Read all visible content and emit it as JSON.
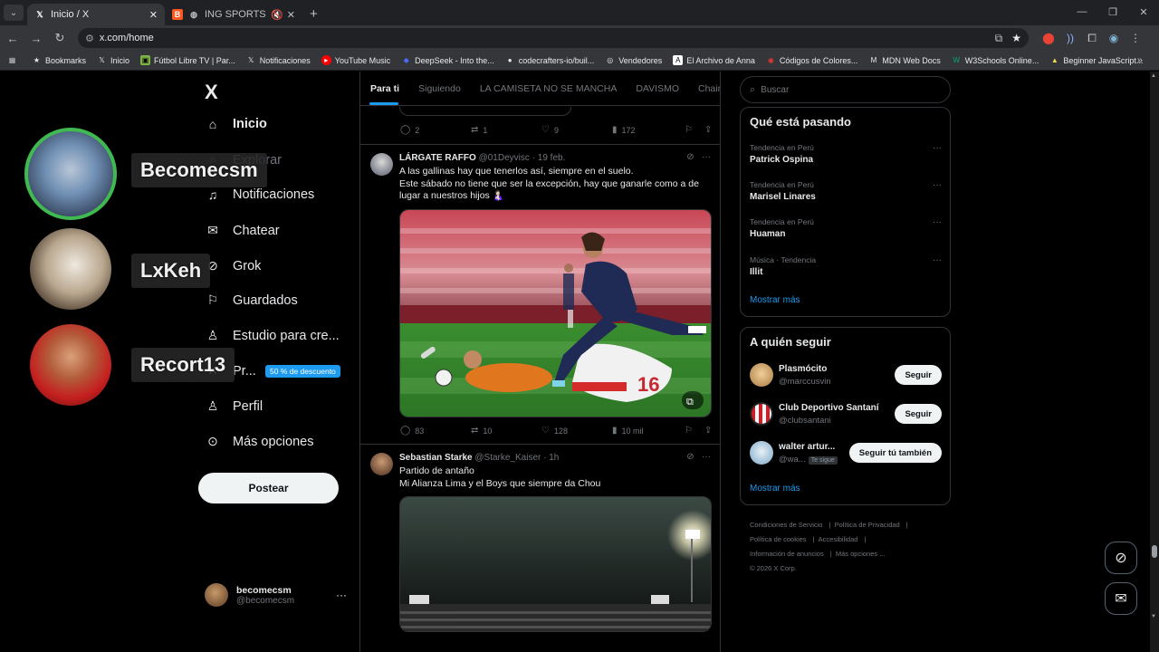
{
  "browser": {
    "tabs": [
      {
        "title": "Inicio / X",
        "active": true
      },
      {
        "title": "ING SPORTS - Deportes",
        "active": false
      }
    ],
    "url": "x.com/home",
    "bookmarks": [
      "Bookmarks",
      "Inicio",
      "Fútbol Libre TV | Par...",
      "Notificaciones",
      "YouTube Music",
      "DeepSeek - Into the...",
      "codecrafters-io/buil...",
      "Vendedores",
      "El Archivo de Anna",
      "Códigos de Colores...",
      "MDN Web Docs",
      "W3Schools Online...",
      "Beginner JavaScript..."
    ]
  },
  "overlay": {
    "users": [
      "Becomecsm",
      "LxKeh",
      "Recort13"
    ]
  },
  "sidebar": {
    "logo": "X",
    "items": [
      {
        "label": "Inicio",
        "icon": "home-icon"
      },
      {
        "label": "Explorar",
        "icon": "search-icon"
      },
      {
        "label": "Notificaciones",
        "icon": "bell-icon"
      },
      {
        "label": "Chatear",
        "icon": "mail-icon"
      },
      {
        "label": "Grok",
        "icon": "grok-icon"
      },
      {
        "label": "Guardados",
        "icon": "bookmark-icon"
      },
      {
        "label": "Estudio para cre...",
        "icon": "studio-icon"
      },
      {
        "label": "Pr...",
        "icon": "premium-icon"
      },
      {
        "label": "Perfil",
        "icon": "person-icon"
      },
      {
        "label": "Más opciones",
        "icon": "more-circle-icon"
      }
    ],
    "promo_badge": "50 % de descuento",
    "post_button": "Postear",
    "account": {
      "name": "becomecsm",
      "handle": "@becomecsm"
    }
  },
  "feed": {
    "tabs": [
      "Para ti",
      "Siguiendo",
      "LA CAMISETA NO SE MANCHA",
      "DAVISMO",
      "Chainsa"
    ],
    "prev_stats": {
      "replies": "2",
      "reposts": "1",
      "likes": "9",
      "views": "172"
    },
    "tweets": [
      {
        "name": "LÁRGATE RAFFO",
        "handle": "@01Deyvisc",
        "time": "19 feb.",
        "line1": "A las gallinas hay que tenerlos así, siempre en el suelo.",
        "line2": "Este sábado no tiene que ser la excepción, hay que ganarle como a de lugar a nuestros hijos 🤱🏻",
        "stats": {
          "replies": "83",
          "reposts": "10",
          "likes": "128",
          "views": "10 mil"
        }
      },
      {
        "name": "Sebastian Starke",
        "handle": "@Starke_Kaiser",
        "time": "1h",
        "line1": "Partido de antaño",
        "line2": "Mi Alianza Lima y el Boys que siempre da Chou"
      }
    ]
  },
  "right": {
    "search_placeholder": "Buscar",
    "trends_title": "Qué está pasando",
    "trends": [
      {
        "context": "Tendencia en Perú",
        "title": "Patrick Ospina"
      },
      {
        "context": "Tendencia en Perú",
        "title": "Marisel Linares"
      },
      {
        "context": "Tendencia en Perú",
        "title": "Huaman"
      },
      {
        "context": "Música · Tendencia",
        "title": "Illit"
      }
    ],
    "show_more": "Mostrar más",
    "who_title": "A quién seguir",
    "who": [
      {
        "name": "Plasmócito",
        "handle": "@marccusvin",
        "button": "Seguir"
      },
      {
        "name": "Club Deportivo Santaní",
        "handle": "@clubsantani",
        "button": "Seguir"
      },
      {
        "name": "walter artur...",
        "handle": "@wa...",
        "badge": "Te sigue",
        "button": "Seguir tú también"
      }
    ],
    "footer": [
      "Condiciones de Servicio",
      "Política de Privacidad",
      "Política de cookies",
      "Accesibilidad",
      "Información de anuncios",
      "Más opciones ...",
      "© 2026 X Corp."
    ]
  }
}
